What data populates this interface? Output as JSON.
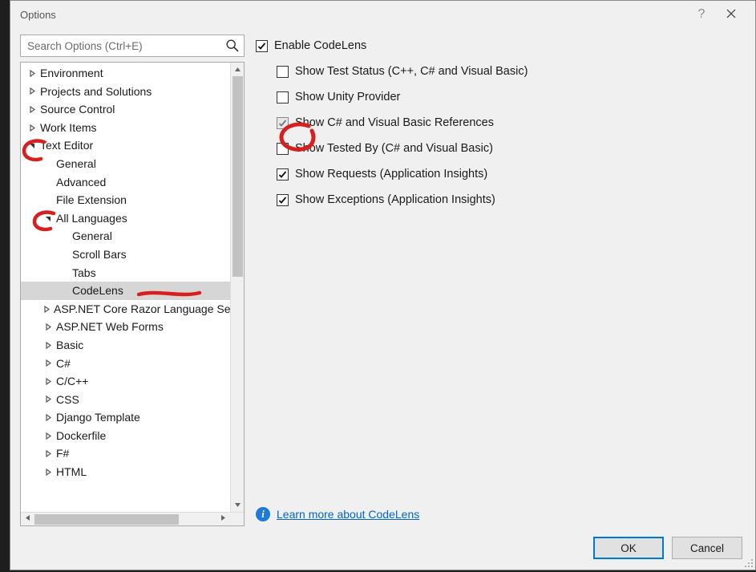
{
  "window": {
    "title": "Options",
    "help_tooltip": "?"
  },
  "search": {
    "placeholder": "Search Options (Ctrl+E)",
    "value": ""
  },
  "tree": {
    "items": [
      {
        "label": "Environment",
        "depth": 1,
        "expander": "closed",
        "selected": false
      },
      {
        "label": "Projects and Solutions",
        "depth": 1,
        "expander": "closed",
        "selected": false
      },
      {
        "label": "Source Control",
        "depth": 1,
        "expander": "closed",
        "selected": false
      },
      {
        "label": "Work Items",
        "depth": 1,
        "expander": "closed",
        "selected": false
      },
      {
        "label": "Text Editor",
        "depth": 1,
        "expander": "open",
        "selected": false
      },
      {
        "label": "General",
        "depth": 2,
        "expander": "none",
        "selected": false
      },
      {
        "label": "Advanced",
        "depth": 2,
        "expander": "none",
        "selected": false
      },
      {
        "label": "File Extension",
        "depth": 2,
        "expander": "none",
        "selected": false
      },
      {
        "label": "All Languages",
        "depth": 2,
        "expander": "open",
        "selected": false
      },
      {
        "label": "General",
        "depth": 3,
        "expander": "none",
        "selected": false
      },
      {
        "label": "Scroll Bars",
        "depth": 3,
        "expander": "none",
        "selected": false
      },
      {
        "label": "Tabs",
        "depth": 3,
        "expander": "none",
        "selected": false
      },
      {
        "label": "CodeLens",
        "depth": 3,
        "expander": "none",
        "selected": true
      },
      {
        "label": "ASP.NET Core Razor Language Service",
        "depth": 2,
        "expander": "closed",
        "selected": false
      },
      {
        "label": "ASP.NET Web Forms",
        "depth": 2,
        "expander": "closed",
        "selected": false
      },
      {
        "label": "Basic",
        "depth": 2,
        "expander": "closed",
        "selected": false
      },
      {
        "label": "C#",
        "depth": 2,
        "expander": "closed",
        "selected": false
      },
      {
        "label": "C/C++",
        "depth": 2,
        "expander": "closed",
        "selected": false
      },
      {
        "label": "CSS",
        "depth": 2,
        "expander": "closed",
        "selected": false
      },
      {
        "label": "Django Template",
        "depth": 2,
        "expander": "closed",
        "selected": false
      },
      {
        "label": "Dockerfile",
        "depth": 2,
        "expander": "closed",
        "selected": false
      },
      {
        "label": "F#",
        "depth": 2,
        "expander": "closed",
        "selected": false
      },
      {
        "label": "HTML",
        "depth": 2,
        "expander": "closed",
        "selected": false
      }
    ]
  },
  "options": {
    "enable_label": "Enable CodeLens",
    "enable_checked": true,
    "items": [
      {
        "label": "Show Test Status (C++, C# and Visual Basic)",
        "checked": false,
        "disabled": false
      },
      {
        "label": "Show Unity Provider",
        "checked": false,
        "disabled": false
      },
      {
        "label": "Show C# and Visual Basic References",
        "checked": true,
        "disabled": true
      },
      {
        "label": "Show Tested By (C# and Visual Basic)",
        "checked": false,
        "disabled": false
      },
      {
        "label": "Show Requests (Application Insights)",
        "checked": true,
        "disabled": false
      },
      {
        "label": "Show Exceptions (Application Insights)",
        "checked": true,
        "disabled": false
      }
    ]
  },
  "learn_more": "Learn more about CodeLens",
  "buttons": {
    "ok": "OK",
    "cancel": "Cancel"
  }
}
